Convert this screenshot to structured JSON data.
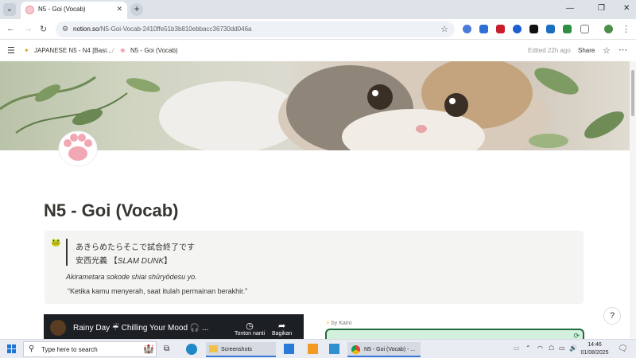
{
  "browser": {
    "tab_title": "N5 - Goi (Vocab)",
    "url_host": "notion.so",
    "url_path": "/N5-Goi-Vocab-2410ffe51b3b810ebbacc36730dd046a"
  },
  "notion": {
    "breadcrumb_parent": "JAPANESE N5 - N4 [Basi...",
    "breadcrumb_current": "N5 - Goi (Vocab)",
    "edited": "Edited 22h ago",
    "share": "Share",
    "page_title": "N5 - Goi (Vocab)",
    "callout": {
      "quote_line1": "あきらめたらそこで試合終了です",
      "quote_line2_prefix": "安西光義 【",
      "quote_line2_italic": "SLAM DUNK",
      "quote_line2_suffix": "】",
      "romaji": "Akirametara sokode shiai shūryōdesu yo.",
      "translation": "“Ketika kamu menyerah, saat itulah permainan berakhir.”"
    },
    "video": {
      "title": "Rainy Day ☔ Chilling Your Mood 🎧 ...",
      "watch_later": "Tonton nanti",
      "share": "Bagikan"
    },
    "widget_by": "by Kairo",
    "help": "?"
  },
  "taskbar": {
    "search_placeholder": "Type here to search",
    "explorer_label": "Screenshots",
    "chrome_label": "N5 - Goi (Vocab) - ...",
    "time": "14:46",
    "date": "01/08/2025"
  },
  "colors": {
    "notion_text": "#37352f",
    "callout_bg": "#f4f4f3",
    "widget_border": "#1f6e3d",
    "widget_bg": "#d3f0df"
  }
}
